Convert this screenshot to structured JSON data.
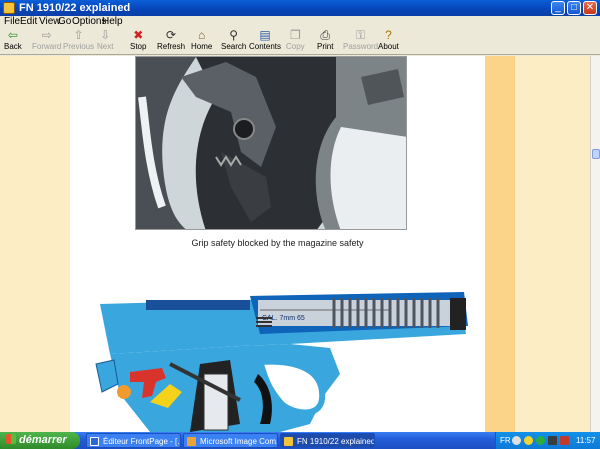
{
  "window": {
    "title": "FN 1910/22 explained",
    "controls": [
      "minimize",
      "maximize",
      "close"
    ]
  },
  "menu": [
    "File",
    "Edit",
    "View",
    "Go",
    "Options",
    "Help"
  ],
  "toolbar": [
    {
      "label": "Back",
      "icon": "back-arrow-icon",
      "enabled": true,
      "glyph": "⇦",
      "color": "#2a8c2a"
    },
    {
      "label": "Forward",
      "icon": "forward-arrow-icon",
      "enabled": false,
      "glyph": "⇨",
      "color": "#999"
    },
    {
      "label": "Previous",
      "icon": "up-arrow-icon",
      "enabled": false,
      "glyph": "⇧",
      "color": "#999"
    },
    {
      "label": "Next",
      "icon": "down-arrow-icon",
      "enabled": false,
      "glyph": "⇩",
      "color": "#999"
    },
    {
      "label": "Stop",
      "icon": "stop-icon",
      "enabled": true,
      "glyph": "✖",
      "color": "#d32020"
    },
    {
      "label": "Refresh",
      "icon": "refresh-icon",
      "enabled": true,
      "glyph": "⟳",
      "color": "#333"
    },
    {
      "label": "Home",
      "icon": "home-icon",
      "enabled": true,
      "glyph": "⌂",
      "color": "#8a5a2a"
    },
    {
      "label": "Search",
      "icon": "search-icon",
      "enabled": true,
      "glyph": "⚲",
      "color": "#333"
    },
    {
      "label": "Contents",
      "icon": "contents-icon",
      "enabled": true,
      "glyph": "▤",
      "color": "#2a5aa8"
    },
    {
      "label": "Copy",
      "icon": "copy-icon",
      "enabled": false,
      "glyph": "❐",
      "color": "#999"
    },
    {
      "label": "Print",
      "icon": "print-icon",
      "enabled": true,
      "glyph": "⎙",
      "color": "#333"
    },
    {
      "label": "Password",
      "icon": "key-icon",
      "enabled": false,
      "glyph": "⚿",
      "color": "#999"
    },
    {
      "label": "About",
      "icon": "about-icon",
      "enabled": true,
      "glyph": "?",
      "color": "#a8740a"
    }
  ],
  "content": {
    "caption": "Grip safety blocked by the magazine safety",
    "diagram_text": "CAL. 7mm 65"
  },
  "taskbar": {
    "start_label": "démarrer",
    "tasks": [
      {
        "label": "Éditeur FrontPage - [...",
        "active": false
      },
      {
        "label": "Microsoft Image Com...",
        "active": false
      },
      {
        "label": "FN 1910/22 explained",
        "active": true
      }
    ],
    "tray": {
      "lang": "FR",
      "clock": "11:57"
    }
  }
}
